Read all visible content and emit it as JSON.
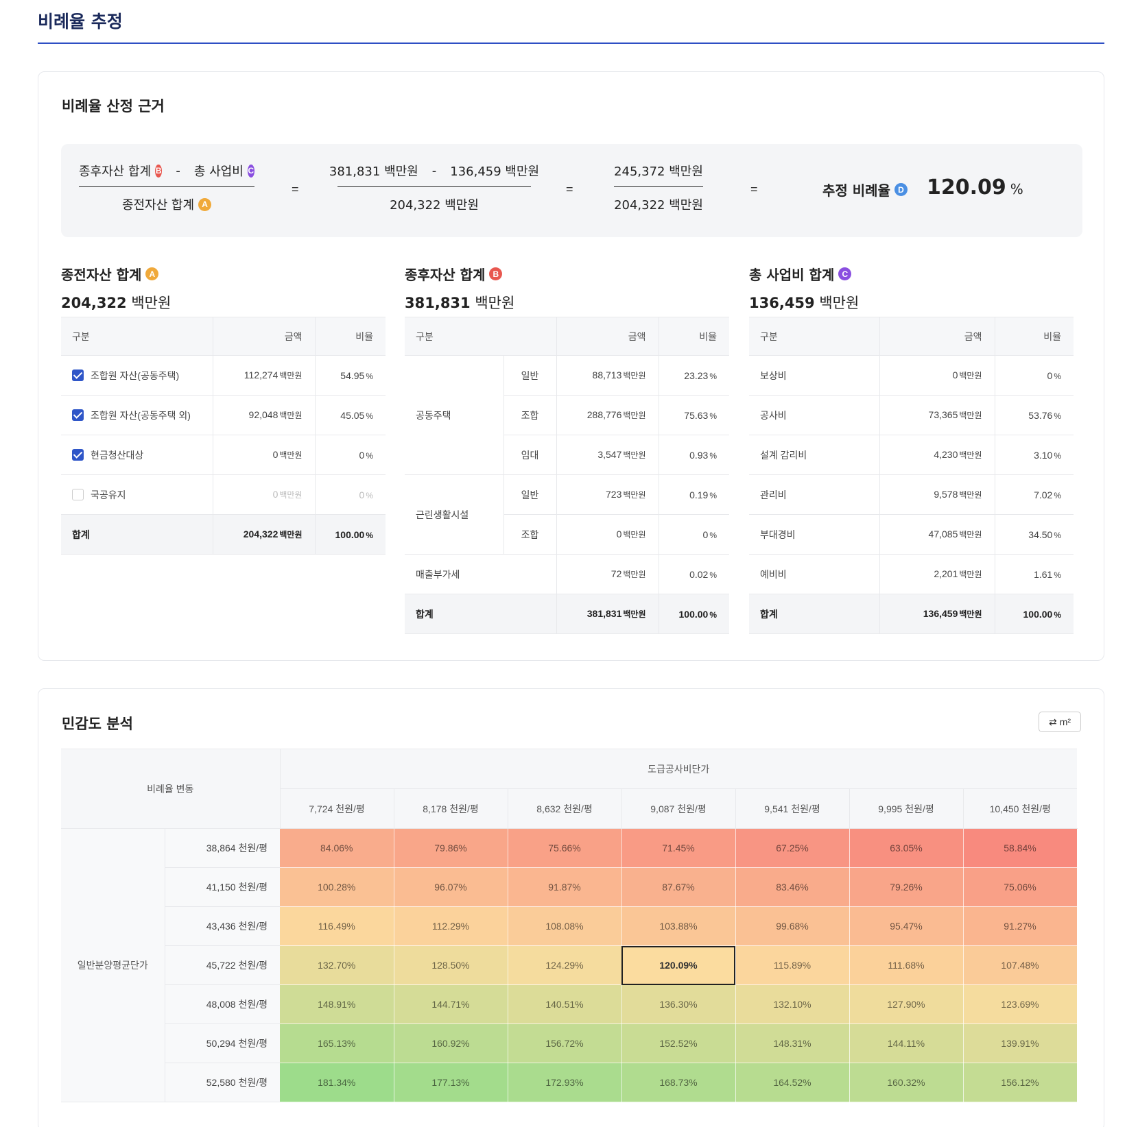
{
  "page": {
    "title": "비례율 추정"
  },
  "basis": {
    "title": "비례율 산정 근거",
    "formula": {
      "num_left": "종후자산 합계",
      "num_left_badge": "B",
      "minus": "-",
      "num_right": "총 사업비",
      "num_right_badge": "C",
      "den": "종전자산 합계",
      "den_badge": "A",
      "eq": "=",
      "step1_num_a": "381,831 백만원",
      "step1_num_b": "136,459 백만원",
      "step1_den": "204,322 백만원",
      "step2_num": "245,372 백만원",
      "step2_den": "204,322 백만원",
      "result_label": "추정 비례율",
      "result_badge": "D",
      "result_value": "120.09",
      "result_unit": "%"
    },
    "sections": {
      "a": {
        "title": "종전자산 합계",
        "badge": "A",
        "total_value": "204,322",
        "total_unit": "백만원"
      },
      "b": {
        "title": "종후자산 합계",
        "badge": "B",
        "total_value": "381,831",
        "total_unit": "백만원"
      },
      "c": {
        "title": "총 사업비 합계",
        "badge": "C",
        "total_value": "136,459",
        "total_unit": "백만원"
      }
    },
    "headers": {
      "category": "구분",
      "amount": "금액",
      "ratio": "비율"
    },
    "unit": "백만원",
    "pct": "%",
    "table_a": {
      "rows": [
        {
          "label": "조합원 자산(공동주택)",
          "checked": true,
          "amount": "112,274",
          "ratio": "54.95"
        },
        {
          "label": "조합원 자산(공동주택 외)",
          "checked": true,
          "amount": "92,048",
          "ratio": "45.05"
        },
        {
          "label": "현금청산대상",
          "checked": true,
          "amount": "0",
          "ratio": "0"
        },
        {
          "label": "국공유지",
          "checked": false,
          "amount": "0",
          "ratio": "0"
        }
      ],
      "total": {
        "label": "합계",
        "amount": "204,322",
        "ratio": "100.00"
      }
    },
    "table_b": {
      "group1": "공동주택",
      "group2": "근린생활시설",
      "rows": [
        {
          "sub": "일반",
          "amount": "88,713",
          "ratio": "23.23"
        },
        {
          "sub": "조합",
          "amount": "288,776",
          "ratio": "75.63"
        },
        {
          "sub": "임대",
          "amount": "3,547",
          "ratio": "0.93"
        },
        {
          "sub": "일반",
          "amount": "723",
          "ratio": "0.19"
        },
        {
          "sub": "조합",
          "amount": "0",
          "ratio": "0"
        }
      ],
      "vat": {
        "label": "매출부가세",
        "amount": "72",
        "ratio": "0.02"
      },
      "total": {
        "label": "합계",
        "amount": "381,831",
        "ratio": "100.00"
      }
    },
    "table_c": {
      "rows": [
        {
          "label": "보상비",
          "amount": "0",
          "ratio": "0"
        },
        {
          "label": "공사비",
          "amount": "73,365",
          "ratio": "53.76"
        },
        {
          "label": "설계 감리비",
          "amount": "4,230",
          "ratio": "3.10"
        },
        {
          "label": "관리비",
          "amount": "9,578",
          "ratio": "7.02"
        },
        {
          "label": "부대경비",
          "amount": "47,085",
          "ratio": "34.50"
        },
        {
          "label": "예비비",
          "amount": "2,201",
          "ratio": "1.61"
        }
      ],
      "total": {
        "label": "합계",
        "amount": "136,459",
        "ratio": "100.00"
      }
    }
  },
  "sensitivity": {
    "title": "민감도 분석",
    "unit_toggle": "m²",
    "corner_label": "비례율 변동",
    "col_group_label": "도급공사비단가",
    "row_group_label": "일반분양평균단가",
    "col_headers": [
      "7,724 천원/평",
      "8,178 천원/평",
      "8,632 천원/평",
      "9,087 천원/평",
      "9,541 천원/평",
      "9,995 천원/평",
      "10,450 천원/평"
    ],
    "row_headers": [
      "38,864 천원/평",
      "41,150 천원/평",
      "43,436 천원/평",
      "45,722 천원/평",
      "48,008 천원/평",
      "50,294 천원/평",
      "52,580 천원/평"
    ],
    "values": [
      [
        "84.06%",
        "79.86%",
        "75.66%",
        "71.45%",
        "67.25%",
        "63.05%",
        "58.84%"
      ],
      [
        "100.28%",
        "96.07%",
        "91.87%",
        "87.67%",
        "83.46%",
        "79.26%",
        "75.06%"
      ],
      [
        "116.49%",
        "112.29%",
        "108.08%",
        "103.88%",
        "99.68%",
        "95.47%",
        "91.27%"
      ],
      [
        "132.70%",
        "128.50%",
        "124.29%",
        "120.09%",
        "115.89%",
        "111.68%",
        "107.48%"
      ],
      [
        "148.91%",
        "144.71%",
        "140.51%",
        "136.30%",
        "132.10%",
        "127.90%",
        "123.69%"
      ],
      [
        "165.13%",
        "160.92%",
        "156.72%",
        "152.52%",
        "148.31%",
        "144.11%",
        "139.91%"
      ],
      [
        "181.34%",
        "177.13%",
        "172.93%",
        "168.73%",
        "164.52%",
        "160.32%",
        "156.12%"
      ]
    ],
    "selected": {
      "row": 3,
      "col": 3
    },
    "colors": {
      "low": "#f88a7e",
      "mid": "#fbdc9f",
      "high": "#9ddc8b"
    }
  }
}
